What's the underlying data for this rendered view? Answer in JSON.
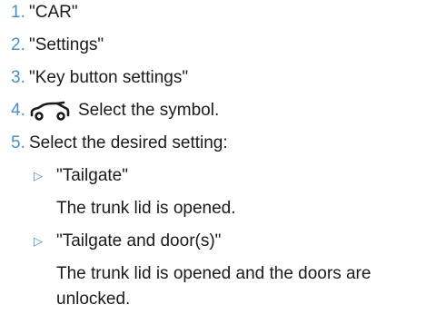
{
  "steps": [
    {
      "num": "1.",
      "text": "\"CAR\""
    },
    {
      "num": "2.",
      "text": "\"Settings\""
    },
    {
      "num": "3.",
      "text": "\"Key button settings\""
    },
    {
      "num": "4.",
      "text": "Select the symbol.",
      "icon": "car-tailgate-icon"
    },
    {
      "num": "5.",
      "text": "Select the desired setting:"
    }
  ],
  "options": [
    {
      "bullet": "▷",
      "label": "\"Tailgate\"",
      "description": [
        "The trunk lid is opened."
      ]
    },
    {
      "bullet": "▷",
      "label": "\"Tailgate and door(s)\"",
      "description": [
        "The trunk lid is opened and the doors are",
        "unlocked."
      ]
    }
  ],
  "colors": {
    "accent": "#4a90c8",
    "text": "#1a1a1a"
  }
}
